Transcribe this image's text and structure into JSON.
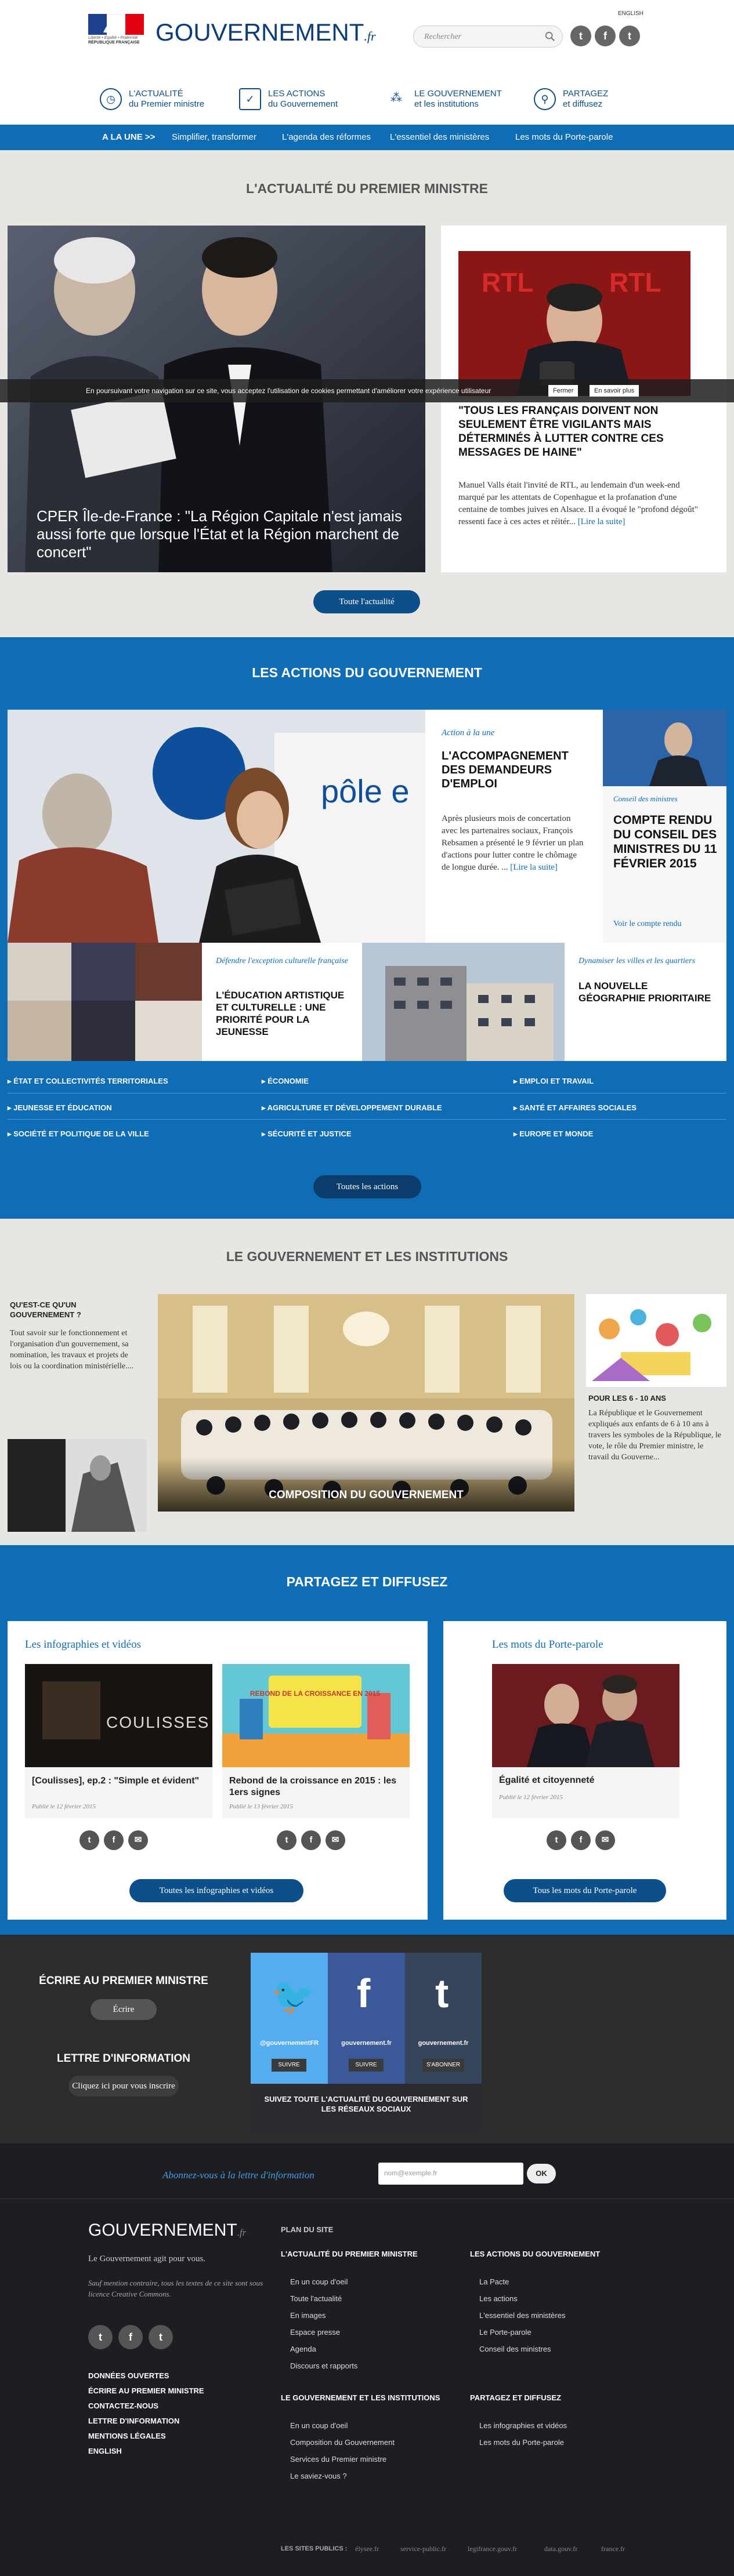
{
  "header": {
    "lang": "ENGLISH",
    "brand": "GOUVERNEMENT",
    "brand_suffix": ".fr",
    "logo_text_1": "Liberté • Égalité • Fraternité",
    "logo_text_2": "RÉPUBLIQUE FRANÇAISE",
    "search_placeholder": "Rechercher",
    "social": [
      "t",
      "f",
      "t"
    ],
    "nav": [
      {
        "icon": "clock-icon",
        "line1": "L'actualité",
        "line2": "du Premier ministre"
      },
      {
        "icon": "check-icon",
        "line1": "Les actions",
        "line2": "du Gouvernement"
      },
      {
        "icon": "people-icon",
        "line1": "Le Gouvernement",
        "line2": "et les institutions"
      },
      {
        "icon": "share-icon",
        "line1": "Partagez",
        "line2": "et diffusez"
      }
    ]
  },
  "subnav": [
    "A LA UNE >>",
    "Simplifier, transformer",
    "L'agenda des réformes",
    "L'essentiel des ministères",
    "Les mots du Porte-parole"
  ],
  "cookie": {
    "message": "En poursuivant votre navigation sur ce site, vous acceptez l'utilisation de cookies permettant d'améliorer votre expérience utilisateur",
    "close": "Fermer",
    "more": "En savoir plus"
  },
  "actualite": {
    "title": "L'actualité du Premier ministre",
    "main_caption": "CPER Île-de-France : \"La Région Capitale n'est jamais aussi forte que lorsque l'État et la Région marchent de concert\"",
    "side_title": "\"TOUS LES FRANÇAIS DOIVENT NON SEULEMENT ÊTRE VIGILANTS MAIS DÉTERMINÉS À LUTTER CONTRE CES MESSAGES DE HAINE\"",
    "side_text": "Manuel Valls était l'invité de RTL, au lendemain d'un week-end marqué par les attentats de Copenhague et la profanation d'une centaine de tombes juives en Alsace. Il a évoqué le \"profond dégoût\" ressenti face à ces actes et réitér...",
    "read_more": "[Lire la suite]",
    "button": "Toute l'actualité"
  },
  "actions": {
    "title": "Les actions du Gouvernement",
    "feature_tag": "Action à la une",
    "feature_title": "L'ACCOMPAGNEMENT DES DEMANDEURS D'EMPLOI",
    "feature_text": "Après plusieurs mois de concertation avec les partenaires sociaux, François Rebsamen a présenté le 9 février un plan d'actions pour lutter contre le chômage de longue durée. ...",
    "read_more": "[Lire la suite]",
    "conseil_tag": "Conseil des ministres",
    "conseil_title": "COMPTE RENDU DU CONSEIL DES MINISTRES DU 11 FÉVRIER 2015",
    "conseil_link": "Voir le compte rendu",
    "culture_tag": "Défendre l'exception culturelle française",
    "culture_title": "L'ÉDUCATION ARTISTIQUE ET CULTURELLE : UNE PRIORITÉ POUR LA JEUNESSE",
    "geo_tag": "Dynamiser les villes et les quartiers",
    "geo_title": "LA NOUVELLE GÉOGRAPHIE PRIORITAIRE",
    "categories": [
      "État et collectivités territoriales",
      "Économie",
      "Emploi et travail",
      "Jeunesse et éducation",
      "Agriculture et développement durable",
      "Santé et affaires sociales",
      "Société et politique de la ville",
      "Sécurité et justice",
      "Europe et monde"
    ],
    "button": "Toutes les actions"
  },
  "institutions": {
    "title": "Le Gouvernement et les institutions",
    "qui_title": "QU'EST-CE QU'UN GOUVERNEMENT ?",
    "qui_text": "Tout savoir sur le fonctionnement et l'organisation d'un gouvernement, sa nomination, les travaux et projets de lois ou la coordination ministérielle....",
    "composition": "COMPOSITION DU GOUVERNEMENT",
    "kids_title": "POUR LES 6 - 10 ANS",
    "kids_text": "La République et le Gouvernement expliqués aux enfants de 6 à 10 ans à travers les symboles de la République, le vote, le rôle du Premier ministre, le travail du Gouverne..."
  },
  "partagez": {
    "title": "Partagez et diffusez",
    "left_title": "Les infographies et vidéos",
    "right_title": "Les mots du Porte-parole",
    "items": [
      {
        "title": "[Coulisses], ep.2 : \"Simple et évident\"",
        "date": "Publié le 12 février 2015",
        "img_text": "COULISSES"
      },
      {
        "title": "Rebond de la croissance en 2015 : les 1ers signes",
        "date": "Publié le 13 février 2015",
        "img_text": "REBOND DE LA CROISSANCE EN 2015"
      },
      {
        "title": "Égalité et citoyenneté",
        "date": "Publié le 12 février 2015"
      }
    ],
    "left_button": "Toutes les infographies et vidéos",
    "right_button": "Tous les mots du Porte-parole"
  },
  "contact": {
    "ecrire_title": "ÉCRIRE AU PREMIER MINISTRE",
    "ecrire_button": "Écrire",
    "lettre_title": "LETTRE D'INFORMATION",
    "lettre_button": "Cliquez ici pour vous inscrire",
    "social_cards": [
      {
        "handle": "@gouvernementFR",
        "button": "SUIVRE"
      },
      {
        "handle": "gouvernement.fr",
        "button": "SUIVRE"
      },
      {
        "handle": "gouvernement.fr",
        "button": "S'ABONNER"
      }
    ],
    "social_caption": "SUIVEZ TOUTE L'ACTUALITÉ DU GOUVERNEMENT SUR LES RÉSEAUX SOCIAUX"
  },
  "newsletter": {
    "label": "Abonnez-vous à la lettre d'information",
    "placeholder": "nom@exemple.fr",
    "ok": "OK"
  },
  "footer": {
    "brand": "GOUVERNEMENT",
    "brand_suffix": ".fr",
    "tagline": "Le Gouvernement agit pour vous.",
    "license": "Sauf mention contraire, tous les textes de ce site sont sous licence Creative Commons.",
    "links": [
      "DONNÉES OUVERTES",
      "ÉCRIRE AU PREMIER MINISTRE",
      "CONTACTEZ-NOUS",
      "LETTRE D'INFORMATION",
      "MENTIONS LÉGALES",
      "ENGLISH"
    ],
    "plan_title": "PLAN DU SITE",
    "plan": [
      {
        "heading": "L'ACTUALITÉ DU PREMIER MINISTRE",
        "items": [
          "En un coup d'oeil",
          "Toute l'actualité",
          "En images",
          "Espace presse",
          "Agenda",
          "Discours et rapports"
        ]
      },
      {
        "heading": "LES ACTIONS DU GOUVERNEMENT",
        "items": [
          "La Pacte",
          "Les actions",
          "L'essentiel des ministères",
          "Le Porte-parole",
          "Conseil des ministres"
        ]
      },
      {
        "heading": "LE GOUVERNEMENT ET LES INSTITUTIONS",
        "items": [
          "En un coup d'oeil",
          "Composition du Gouvernement",
          "Services du Premier ministre",
          "Le saviez-vous ?"
        ]
      },
      {
        "heading": "PARTAGEZ ET DIFFUSEZ",
        "items": [
          "Les infographies et vidéos",
          "Les mots du Porte-parole"
        ]
      }
    ],
    "sites_label": "LES SITES PUBLICS :",
    "sites": [
      "élysee.fr",
      "service-public.fr",
      "legifrance.gouv.fr",
      "data.gouv.fr",
      "france.fr"
    ]
  }
}
